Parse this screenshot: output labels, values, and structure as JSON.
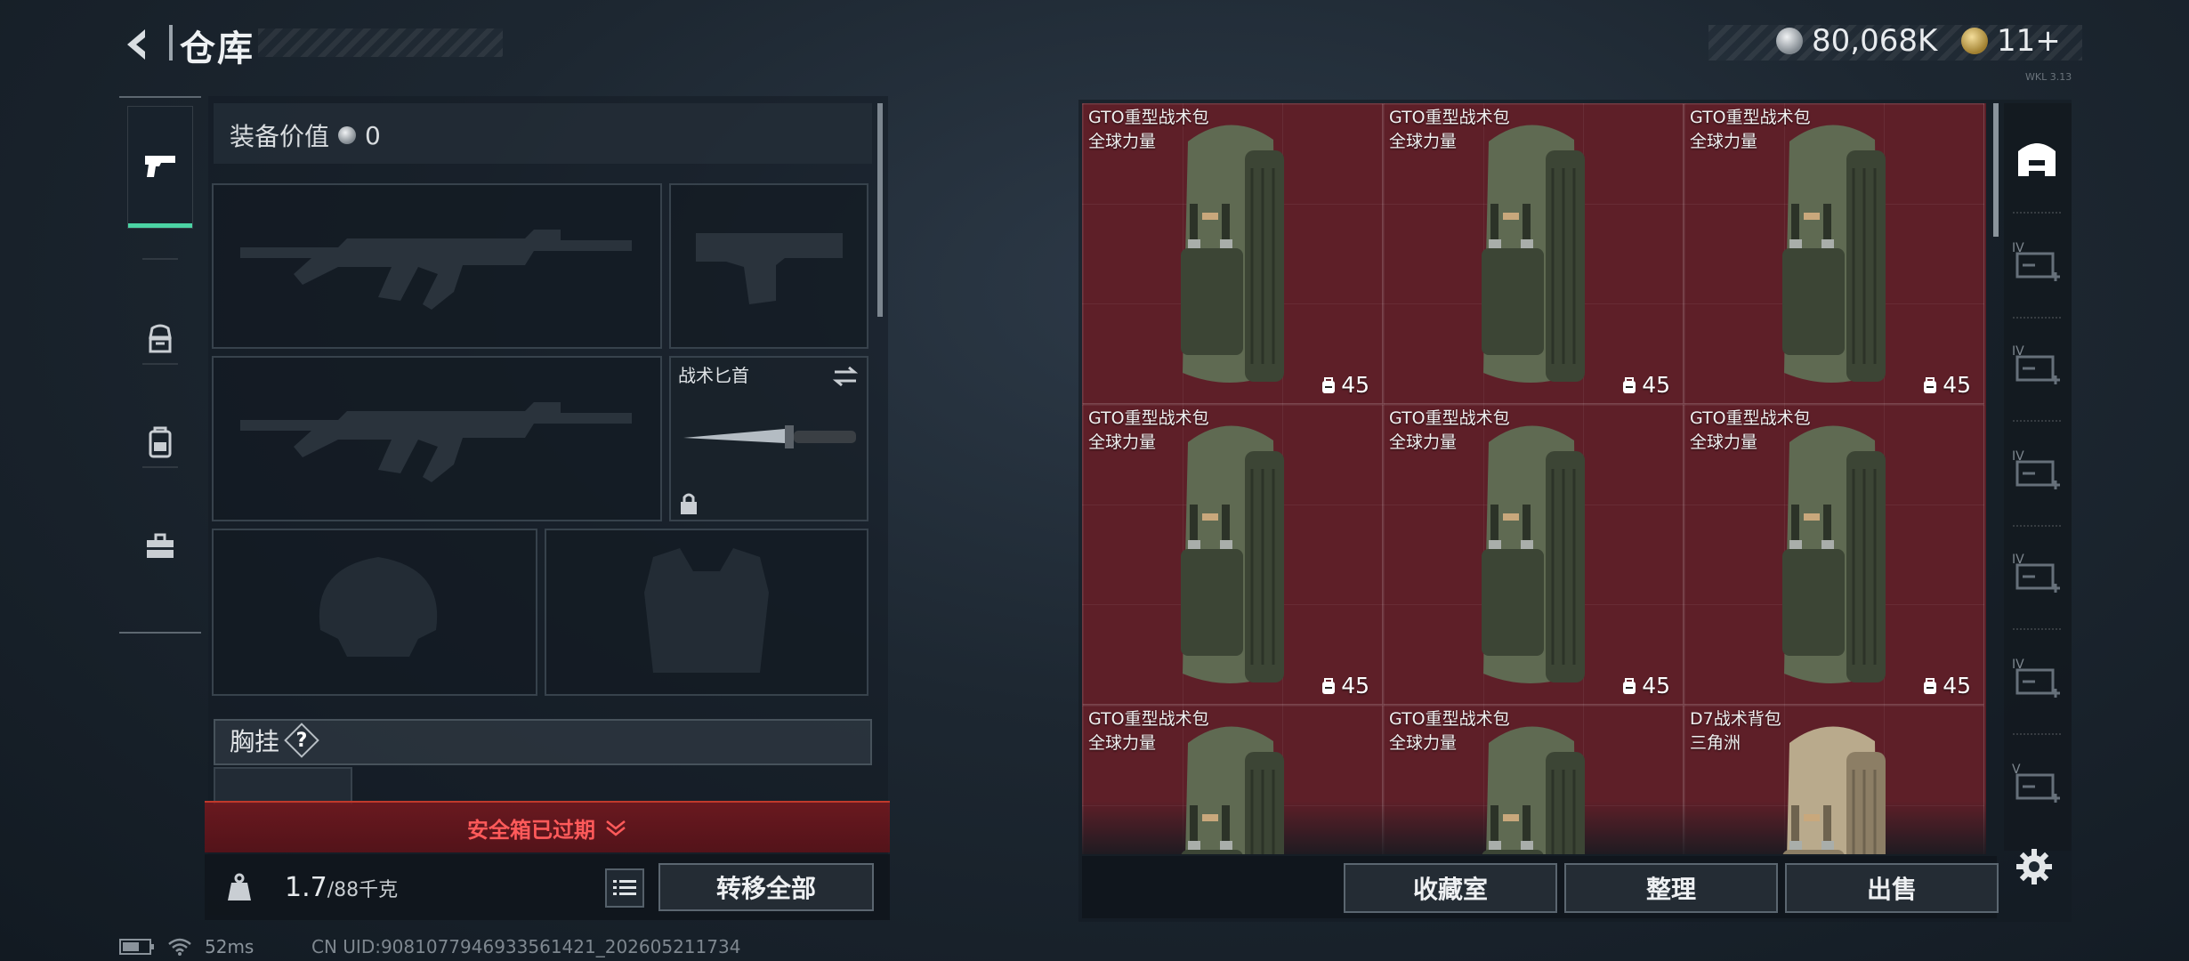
{
  "header": {
    "title": "仓库",
    "currency_1": "80,068K",
    "currency_2": "11+",
    "version_tag": "WKL 3.13"
  },
  "categories": [
    {
      "icon": "pistol-icon",
      "active": true
    },
    {
      "icon": "helmet-armor-icon",
      "active": false
    },
    {
      "icon": "backpack-icon",
      "active": false
    },
    {
      "icon": "toolbox-icon",
      "active": false
    }
  ],
  "loadout": {
    "value_label": "装备价值",
    "value": "0",
    "knife_slot_label": "战术匕首",
    "chest_rig_label": "胸挂",
    "chest_help": "?",
    "safebox_expired": "安全箱已过期",
    "weight_current": "1.7",
    "weight_max": "/88千克",
    "transfer_all": "转移全部"
  },
  "grid": {
    "items": [
      {
        "name": "GTO重型战术包",
        "brand": "全球力量",
        "capacity": "45",
        "color": "green"
      },
      {
        "name": "GTO重型战术包",
        "brand": "全球力量",
        "capacity": "45",
        "color": "green"
      },
      {
        "name": "GTO重型战术包",
        "brand": "全球力量",
        "capacity": "45",
        "color": "green"
      },
      {
        "name": "GTO重型战术包",
        "brand": "全球力量",
        "capacity": "45",
        "color": "green"
      },
      {
        "name": "GTO重型战术包",
        "brand": "全球力量",
        "capacity": "45",
        "color": "green"
      },
      {
        "name": "GTO重型战术包",
        "brand": "全球力量",
        "capacity": "45",
        "color": "green"
      },
      {
        "name": "GTO重型战术包",
        "brand": "全球力量",
        "capacity": "",
        "color": "green"
      },
      {
        "name": "GTO重型战术包",
        "brand": "全球力量",
        "capacity": "",
        "color": "green"
      },
      {
        "name": "D7战术背包",
        "brand": "三角洲",
        "capacity": "",
        "color": "tan"
      }
    ],
    "buttons": {
      "collection": "收藏室",
      "organize": "整理",
      "sell": "出售"
    }
  },
  "storage_tabs": [
    {
      "icon": "storage-home-icon",
      "label": ""
    },
    {
      "icon": "expand-storage-icon",
      "label": "IV"
    },
    {
      "icon": "storage-folder-icon",
      "label": "IV"
    },
    {
      "icon": "storage-case-icon",
      "label": "IV"
    },
    {
      "icon": "expand-storage-icon",
      "label": "IV"
    },
    {
      "icon": "expand-storage-icon",
      "label": "IV"
    },
    {
      "icon": "storage-locked-icon",
      "label": "V"
    }
  ],
  "footer": {
    "ping": "52ms",
    "uid": "CN UID:9081077946933561421_202605211734"
  },
  "colors": {
    "accent_green": "#4bd3a4",
    "grid_bg": "#5e1f28",
    "warning_red": "#ff5a5a"
  }
}
